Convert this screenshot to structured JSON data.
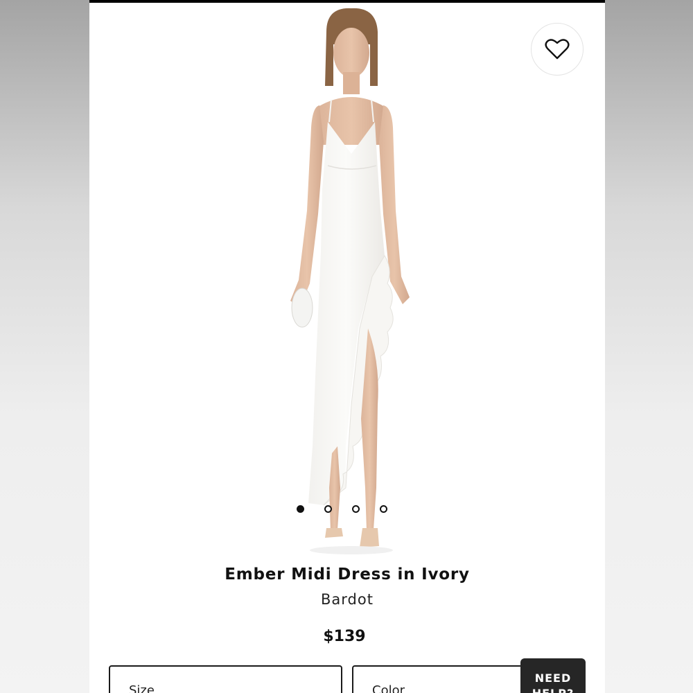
{
  "product": {
    "title": "Ember Midi Dress in Ivory",
    "brand": "Bardot",
    "price": "$139"
  },
  "favorite": {
    "icon": "heart-outline-icon"
  },
  "gallery": {
    "image_count": 4,
    "active_index": 0
  },
  "options": {
    "size_label": "Size",
    "color_label": "Color"
  },
  "help_button": {
    "line1": "NEED",
    "line2": "HELP?"
  },
  "colors": {
    "background": "#ffffff",
    "text": "#111111",
    "help_button": "#262626"
  }
}
